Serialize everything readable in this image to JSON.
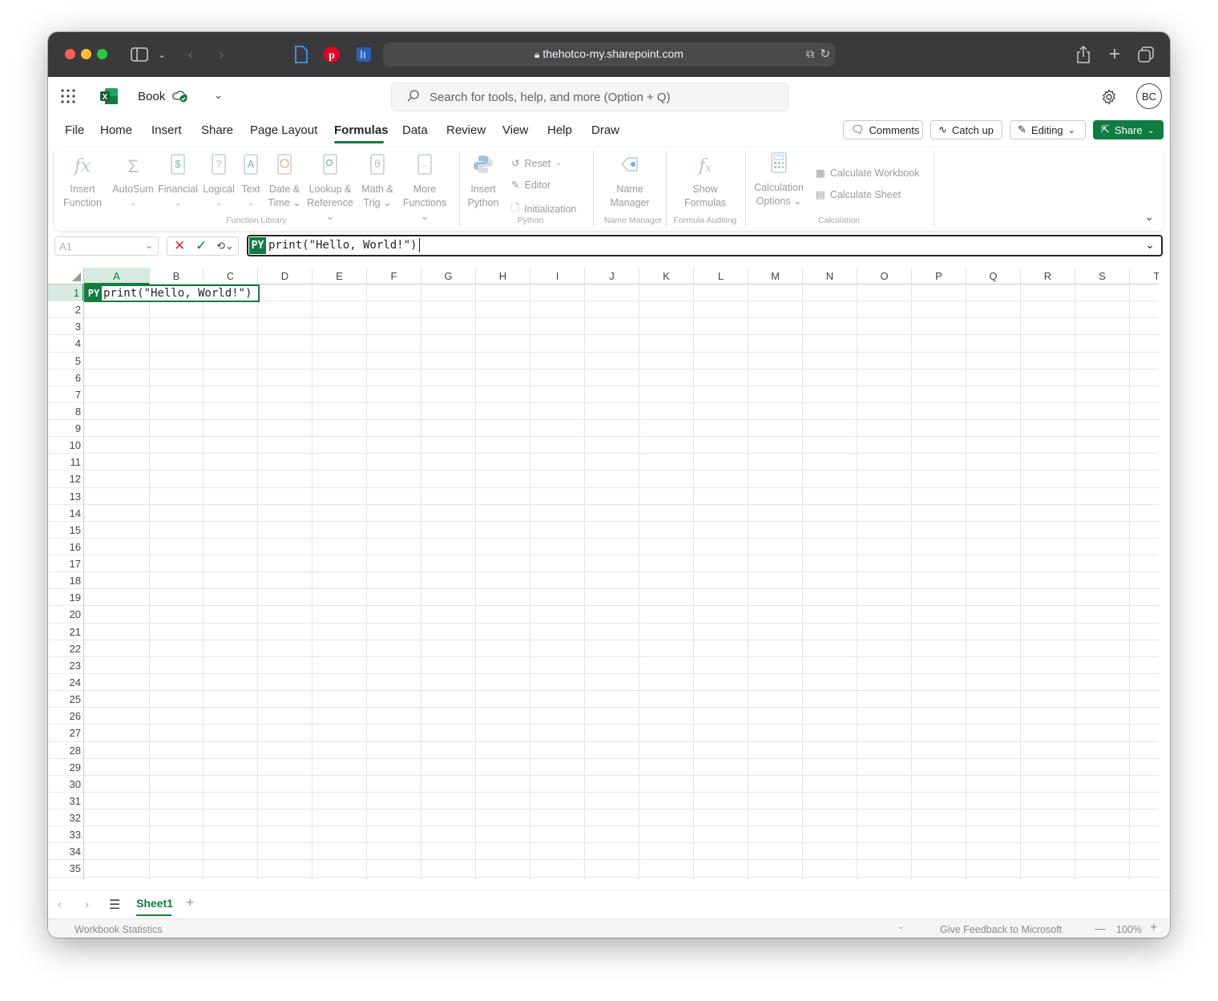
{
  "browser": {
    "url": "thehotco-my.sharepoint.com"
  },
  "app": {
    "workbook_name": "Book",
    "search_placeholder": "Search for tools, help, and more (Option + Q)",
    "avatar_initials": "BC",
    "accent_color": "#107c41"
  },
  "menu": {
    "tabs": [
      "File",
      "Home",
      "Insert",
      "Share",
      "Page Layout",
      "Formulas",
      "Data",
      "Review",
      "View",
      "Help",
      "Draw"
    ],
    "active": "Formulas",
    "comments_label": "Comments",
    "catchup_label": "Catch up",
    "editing_label": "Editing",
    "share_label": "Share"
  },
  "ribbon": {
    "insert_function": [
      "Insert",
      "Function"
    ],
    "autosum": "AutoSum",
    "financial": "Financial",
    "logical": "Logical",
    "text": "Text",
    "datetime": [
      "Date &",
      "Time"
    ],
    "lookup": [
      "Lookup &",
      "Reference"
    ],
    "mathtrig": [
      "Math &",
      "Trig"
    ],
    "more_functions": [
      "More",
      "Functions"
    ],
    "function_library_label": "Function Library",
    "insert_python": [
      "Insert",
      "Python"
    ],
    "reset": "Reset",
    "editor": "Editor",
    "initialization": "Initialization",
    "python_label": "Python",
    "name_manager": [
      "Name",
      "Manager"
    ],
    "name_manager_label": "Name Manager",
    "show_formulas": [
      "Show",
      "Formulas"
    ],
    "formula_auditing_label": "Formula Auditing",
    "calc_options": [
      "Calculation",
      "Options"
    ],
    "calc_workbook": "Calculate Workbook",
    "calc_sheet": "Calculate Sheet",
    "calculation_label": "Calculation"
  },
  "formula_bar": {
    "name_box": "A1",
    "py_badge": "PY",
    "formula": "print(\"Hello, World!\")"
  },
  "grid": {
    "columns": [
      "A",
      "B",
      "C",
      "D",
      "E",
      "F",
      "G",
      "H",
      "I",
      "J",
      "K",
      "L",
      "M",
      "N",
      "O",
      "P",
      "Q",
      "R",
      "S",
      "T"
    ],
    "rows": [
      "1",
      "2",
      "3",
      "4",
      "5",
      "6",
      "7",
      "8",
      "9",
      "10",
      "11",
      "12",
      "13",
      "14",
      "15",
      "16",
      "17",
      "18",
      "19",
      "20",
      "21",
      "22",
      "23",
      "24",
      "25",
      "26",
      "27",
      "28",
      "29",
      "30",
      "31",
      "32",
      "33",
      "34",
      "35"
    ],
    "cell_a1": "print(\"Hello, World!\")",
    "cell_a1_badge": "PY"
  },
  "sheets": {
    "tabs": [
      "Sheet1"
    ]
  },
  "status": {
    "left": "Workbook Statistics",
    "feedback": "Give Feedback to Microsoft",
    "zoom": "100%"
  }
}
